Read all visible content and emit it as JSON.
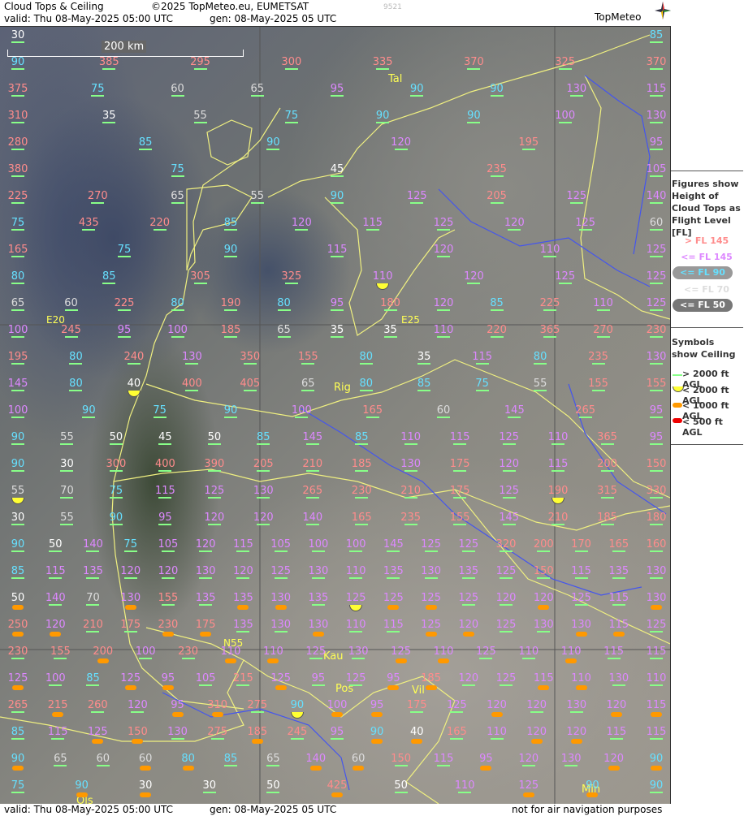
{
  "header": {
    "title": "Cloud Tops & Ceiling",
    "copyright": "©2025 TopMeteo.eu, EUMETSAT",
    "valid": "valid:  Thu  08-May-2025  05:00 UTC",
    "gen": "gen: 08-May-2025 05 UTC",
    "code": "9521",
    "logo": "TopMeteo"
  },
  "scale_bar": {
    "label": "200 km"
  },
  "grid_labels": [
    "E20",
    "E25",
    "N55"
  ],
  "cities": [
    "Tal",
    "Rig",
    "Kau",
    "Pos",
    "Vil",
    "Ols",
    "Min"
  ],
  "colors": {
    "above_fl145": "#ff8c8c",
    "below_fl145": "#dd88ff",
    "below_fl90": "#66e0ff",
    "below_fl70": "#dddddd",
    "below_fl50": "#ffffff",
    "ceiling_ok": "#88ff88",
    "ceiling_2000": "#ffff33",
    "ceiling_1000": "#ff9900",
    "ceiling_500": "#ee0000",
    "border": "#f0f080",
    "river": "#4455ee"
  },
  "legend": {
    "fig_title": "Figures show Height of Cloud Tops as Flight Level  [FL]",
    "fl_rows": [
      "> FL 145",
      "<= FL 145",
      "<= FL 90",
      "<= FL 70",
      "<= FL 50"
    ],
    "sym_title": "Symbols show Ceiling",
    "sym_rows": [
      "> 2000 ft AGL",
      "< 2000 ft AGL",
      "< 1000 ft AGL",
      "< 500 ft AGL"
    ]
  },
  "footer": {
    "valid": "valid:  Thu  08-May-2025  05:00 UTC",
    "gen": "gen: 08-May-2025 05 UTC",
    "note": "not for air navigation purposes"
  },
  "cloud_tops": [
    [
      "30",
      "85",
      "",
      "",
      "",
      "",
      "",
      "",
      "",
      "",
      ""
    ],
    [
      "90",
      "385",
      "295",
      "300",
      "335",
      "370",
      "325",
      "370"
    ],
    [
      "375",
      "75",
      "60",
      "65",
      "95",
      "90",
      "90",
      "130",
      "115"
    ],
    [
      "310",
      "35",
      "55",
      "75",
      "90",
      "90",
      "100",
      "130"
    ],
    [
      "280",
      "85",
      "90",
      "120",
      "195",
      "95"
    ],
    [
      "380",
      "75",
      "45",
      "235",
      "105"
    ],
    [
      "225",
      "270",
      "65",
      "55",
      "90",
      "125",
      "205",
      "125",
      "140"
    ],
    [
      "75",
      "435",
      "220",
      "85",
      "120",
      "115",
      "125",
      "120",
      "125",
      "60"
    ],
    [
      "165",
      "75",
      "90",
      "115",
      "120",
      "110",
      "125"
    ],
    [
      "80",
      "85",
      "305",
      "325",
      "110",
      "120",
      "125",
      "125"
    ],
    [
      "65",
      "60",
      "225",
      "80",
      "190",
      "80",
      "95",
      "180",
      "120",
      "85",
      "225",
      "110",
      "125"
    ],
    [
      "100",
      "245",
      "95",
      "100",
      "185",
      "65",
      "35",
      "35",
      "110",
      "220",
      "365",
      "270",
      "230"
    ],
    [
      "195",
      "80",
      "240",
      "130",
      "350",
      "155",
      "80",
      "35",
      "115",
      "80",
      "235",
      "130"
    ],
    [
      "145",
      "80",
      "40",
      "400",
      "405",
      "65",
      "80",
      "85",
      "75",
      "55",
      "155",
      "155"
    ],
    [
      "100",
      "90",
      "75",
      "90",
      "100",
      "165",
      "60",
      "145",
      "265",
      "95"
    ],
    [
      "90",
      "55",
      "50",
      "45",
      "50",
      "85",
      "145",
      "85",
      "110",
      "115",
      "125",
      "110",
      "365",
      "95"
    ],
    [
      "90",
      "30",
      "300",
      "400",
      "390",
      "205",
      "210",
      "185",
      "130",
      "175",
      "120",
      "115",
      "200",
      "150"
    ],
    [
      "55",
      "70",
      "75",
      "115",
      "125",
      "130",
      "265",
      "230",
      "210",
      "175",
      "125",
      "190",
      "315",
      "330"
    ],
    [
      "30",
      "55",
      "90",
      "95",
      "120",
      "120",
      "140",
      "165",
      "235",
      "155",
      "145",
      "210",
      "185",
      "180"
    ],
    [
      "90",
      "50",
      "140",
      "75",
      "105",
      "120",
      "115",
      "105",
      "100",
      "100",
      "145",
      "125",
      "125",
      "320",
      "200",
      "170",
      "165",
      "160"
    ],
    [
      "85",
      "115",
      "135",
      "120",
      "120",
      "130",
      "120",
      "125",
      "130",
      "110",
      "135",
      "130",
      "135",
      "125",
      "150",
      "115",
      "135",
      "130"
    ],
    [
      "50",
      "140",
      "70",
      "130",
      "155",
      "135",
      "135",
      "130",
      "135",
      "125",
      "125",
      "125",
      "125",
      "120",
      "120",
      "125",
      "115",
      "130"
    ],
    [
      "250",
      "120",
      "210",
      "175",
      "230",
      "175",
      "135",
      "130",
      "130",
      "110",
      "115",
      "125",
      "120",
      "125",
      "130",
      "130",
      "115",
      "125"
    ],
    [
      "230",
      "155",
      "200",
      "100",
      "230",
      "110",
      "110",
      "125",
      "130",
      "125",
      "110",
      "125",
      "110",
      "110",
      "115",
      "115"
    ],
    [
      "125",
      "100",
      "85",
      "125",
      "95",
      "105",
      "215",
      "125",
      "95",
      "125",
      "95",
      "185",
      "120",
      "125",
      "115",
      "110",
      "130",
      "110"
    ],
    [
      "265",
      "215",
      "260",
      "120",
      "95",
      "310",
      "275",
      "90",
      "100",
      "95",
      "175",
      "125",
      "120",
      "120",
      "130",
      "120",
      "115"
    ],
    [
      "85",
      "115",
      "125",
      "150",
      "130",
      "275",
      "185",
      "245",
      "95",
      "90",
      "40",
      "165",
      "110",
      "120",
      "120",
      "115",
      "115"
    ],
    [
      "90",
      "65",
      "60",
      "60",
      "80",
      "85",
      "65",
      "140",
      "60",
      "150",
      "115",
      "95",
      "120",
      "130",
      "120",
      "90"
    ],
    [
      "75",
      "90",
      "30",
      "30",
      "50",
      "425",
      "50",
      "110",
      "125",
      "90",
      "90"
    ]
  ]
}
